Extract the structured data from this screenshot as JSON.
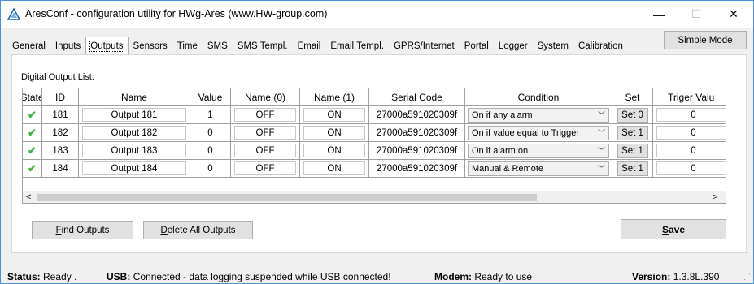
{
  "window": {
    "title": "AresConf - configuration utility for HWg-Ares (www.HW-group.com)",
    "min_icon": "minimize-icon",
    "max_icon": "maximize-icon",
    "close_icon": "close-icon"
  },
  "tabs": [
    "General",
    "Inputs",
    "Outputs",
    "Sensors",
    "Time",
    "SMS",
    "SMS Templ.",
    "Email",
    "Email Templ.",
    "GPRS/Internet",
    "Portal",
    "Logger",
    "System",
    "Calibration"
  ],
  "active_tab": "Outputs",
  "simple_mode_label": "Simple Mode",
  "list_label": "Digital Output List:",
  "table": {
    "headers": [
      "State",
      "ID",
      "Name",
      "Value",
      "Name (0)",
      "Name (1)",
      "Serial Code",
      "Condition",
      "Set",
      "Triger Valu"
    ],
    "rows": [
      {
        "state": "✔",
        "id": "181",
        "name": "Output 181",
        "value": "1",
        "name0": "OFF",
        "name1": "ON",
        "serial": "27000a591020309f",
        "condition": "On if any alarm",
        "set": "Set 0",
        "trigger": "0"
      },
      {
        "state": "✔",
        "id": "182",
        "name": "Output 182",
        "value": "0",
        "name0": "OFF",
        "name1": "ON",
        "serial": "27000a591020309f",
        "condition": "On if value equal to Trigger",
        "set": "Set 1",
        "trigger": "0"
      },
      {
        "state": "✔",
        "id": "183",
        "name": "Output 183",
        "value": "0",
        "name0": "OFF",
        "name1": "ON",
        "serial": "27000a591020309f",
        "condition": "On if alarm on",
        "set": "Set 1",
        "trigger": "0"
      },
      {
        "state": "✔",
        "id": "184",
        "name": "Output 184",
        "value": "0",
        "name0": "OFF",
        "name1": "ON",
        "serial": "27000a591020309f",
        "condition": "Manual & Remote",
        "set": "Set 1",
        "trigger": "0"
      }
    ]
  },
  "buttons": {
    "find_outputs": {
      "accel": "F",
      "rest": "ind Outputs"
    },
    "delete_all": {
      "accel": "D",
      "rest": "elete All Outputs"
    },
    "save": {
      "accel": "S",
      "rest": "ave"
    }
  },
  "status": {
    "status_label": "Status:",
    "status_value": "Ready .",
    "usb_label": "USB:",
    "usb_value": "Connected - data logging suspended while USB connected!",
    "modem_label": "Modem:",
    "modem_value": "Ready to use",
    "version_label": "Version:",
    "version_value": "1.3.8L.390"
  },
  "colors": {
    "state_ok": "#44b044",
    "window_border": "#4a90d9"
  }
}
